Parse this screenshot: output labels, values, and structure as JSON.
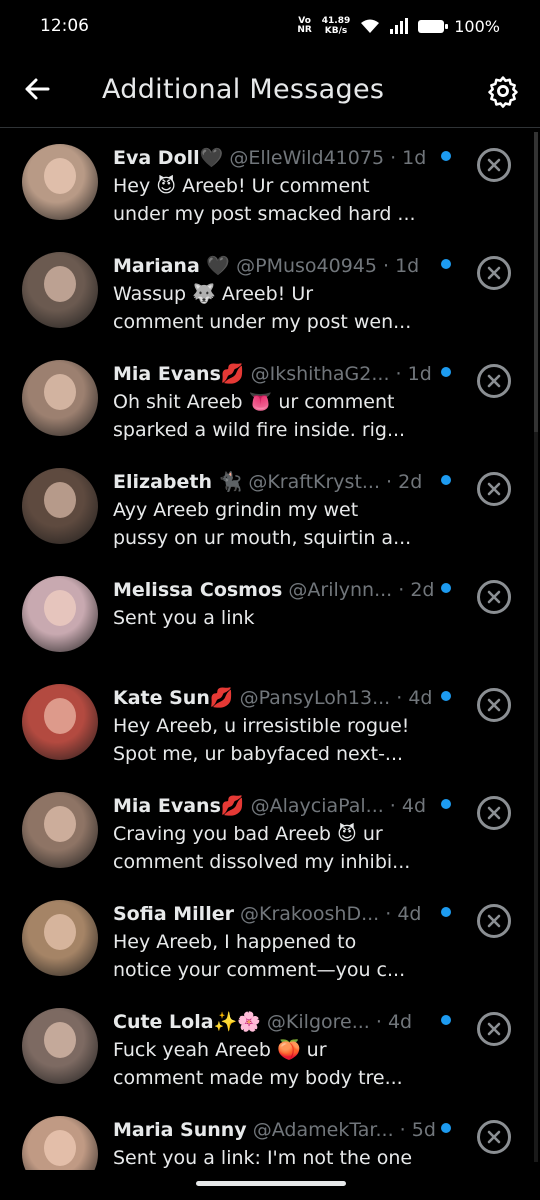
{
  "status": {
    "time": "12:06",
    "net_top": "Vo",
    "net_bottom": "NR",
    "speed_top": "41.89",
    "speed_bottom": "KB/s",
    "battery": "100%"
  },
  "header": {
    "title": "Additional Messages",
    "back_icon": "arrow-left-icon",
    "settings_icon": "gear-icon"
  },
  "colors": {
    "background": "#000000",
    "unread_dot": "#1d9bf0",
    "handle": "#71767b"
  },
  "messages": [
    {
      "name": "Eva Doll🖤",
      "handle": "@ElleWild41075 · 1d",
      "line1": "Hey 😈 Areeb!  Ur comment",
      "line2": "under my post smacked hard ...",
      "avatar_color": "#b89a86"
    },
    {
      "name": "Mariana 🖤",
      "handle": "@PMuso40945 · 1d",
      "line1": "Wassup 🐺 Areeb!  Ur",
      "line2": "comment under my post wen...",
      "avatar_color": "#6b5a50"
    },
    {
      "name": "Mia Evans💋",
      "handle": "@IkshithaG2... · 1d",
      "line1": "Oh shit Areeb 👅  ur comment",
      "line2": "sparked a wild fire inside.   rig...",
      "avatar_color": "#9c8070"
    },
    {
      "name": "Elizabeth 🐈‍⬛",
      "handle": "@KraftKryst...   · 2d",
      "line1": "Ayy Areeb  grindin my wet",
      "line2": "pussy on ur mouth, squirtin a...",
      "avatar_color": "#5e4a3f"
    },
    {
      "name": "Melissa Cosmos",
      "handle": "@Arilynn... · 2d",
      "line1": "Sent you a link",
      "line2": "",
      "avatar_color": "#c8a9b0"
    },
    {
      "name": "Kate Sun💋",
      "handle": "@PansyLoh13... · 4d",
      "line1": "Hey Areeb, u irresistible rogue!",
      "line2": "Spot me, ur babyfaced next-...",
      "avatar_color": "#b34a40"
    },
    {
      "name": "Mia Evans💋",
      "handle": "@AlayciaPal... · 4d",
      "line1": "Craving you bad Areeb 😈   ur",
      "line2": "comment dissolved my inhibi...",
      "avatar_color": "#8e7465"
    },
    {
      "name": "Sofia Miller",
      "handle": "@KrakooshD... · 4d",
      "line1": "Hey Areeb, I happened to",
      "line2": "notice your comment—you c...",
      "avatar_color": "#a58466"
    },
    {
      "name": "Cute Lola✨🌸",
      "handle": "@Kilgore...   · 4d",
      "line1": "Fuck yeah Areeb 🍑   ur",
      "line2": "comment made my body tre...",
      "avatar_color": "#7d6a62"
    },
    {
      "name": "Maria Sunny",
      "handle": "@AdamekTar... · 5d",
      "line1": "Sent you a link: I'm not the one",
      "line2": "",
      "avatar_color": "#c09a84"
    }
  ]
}
